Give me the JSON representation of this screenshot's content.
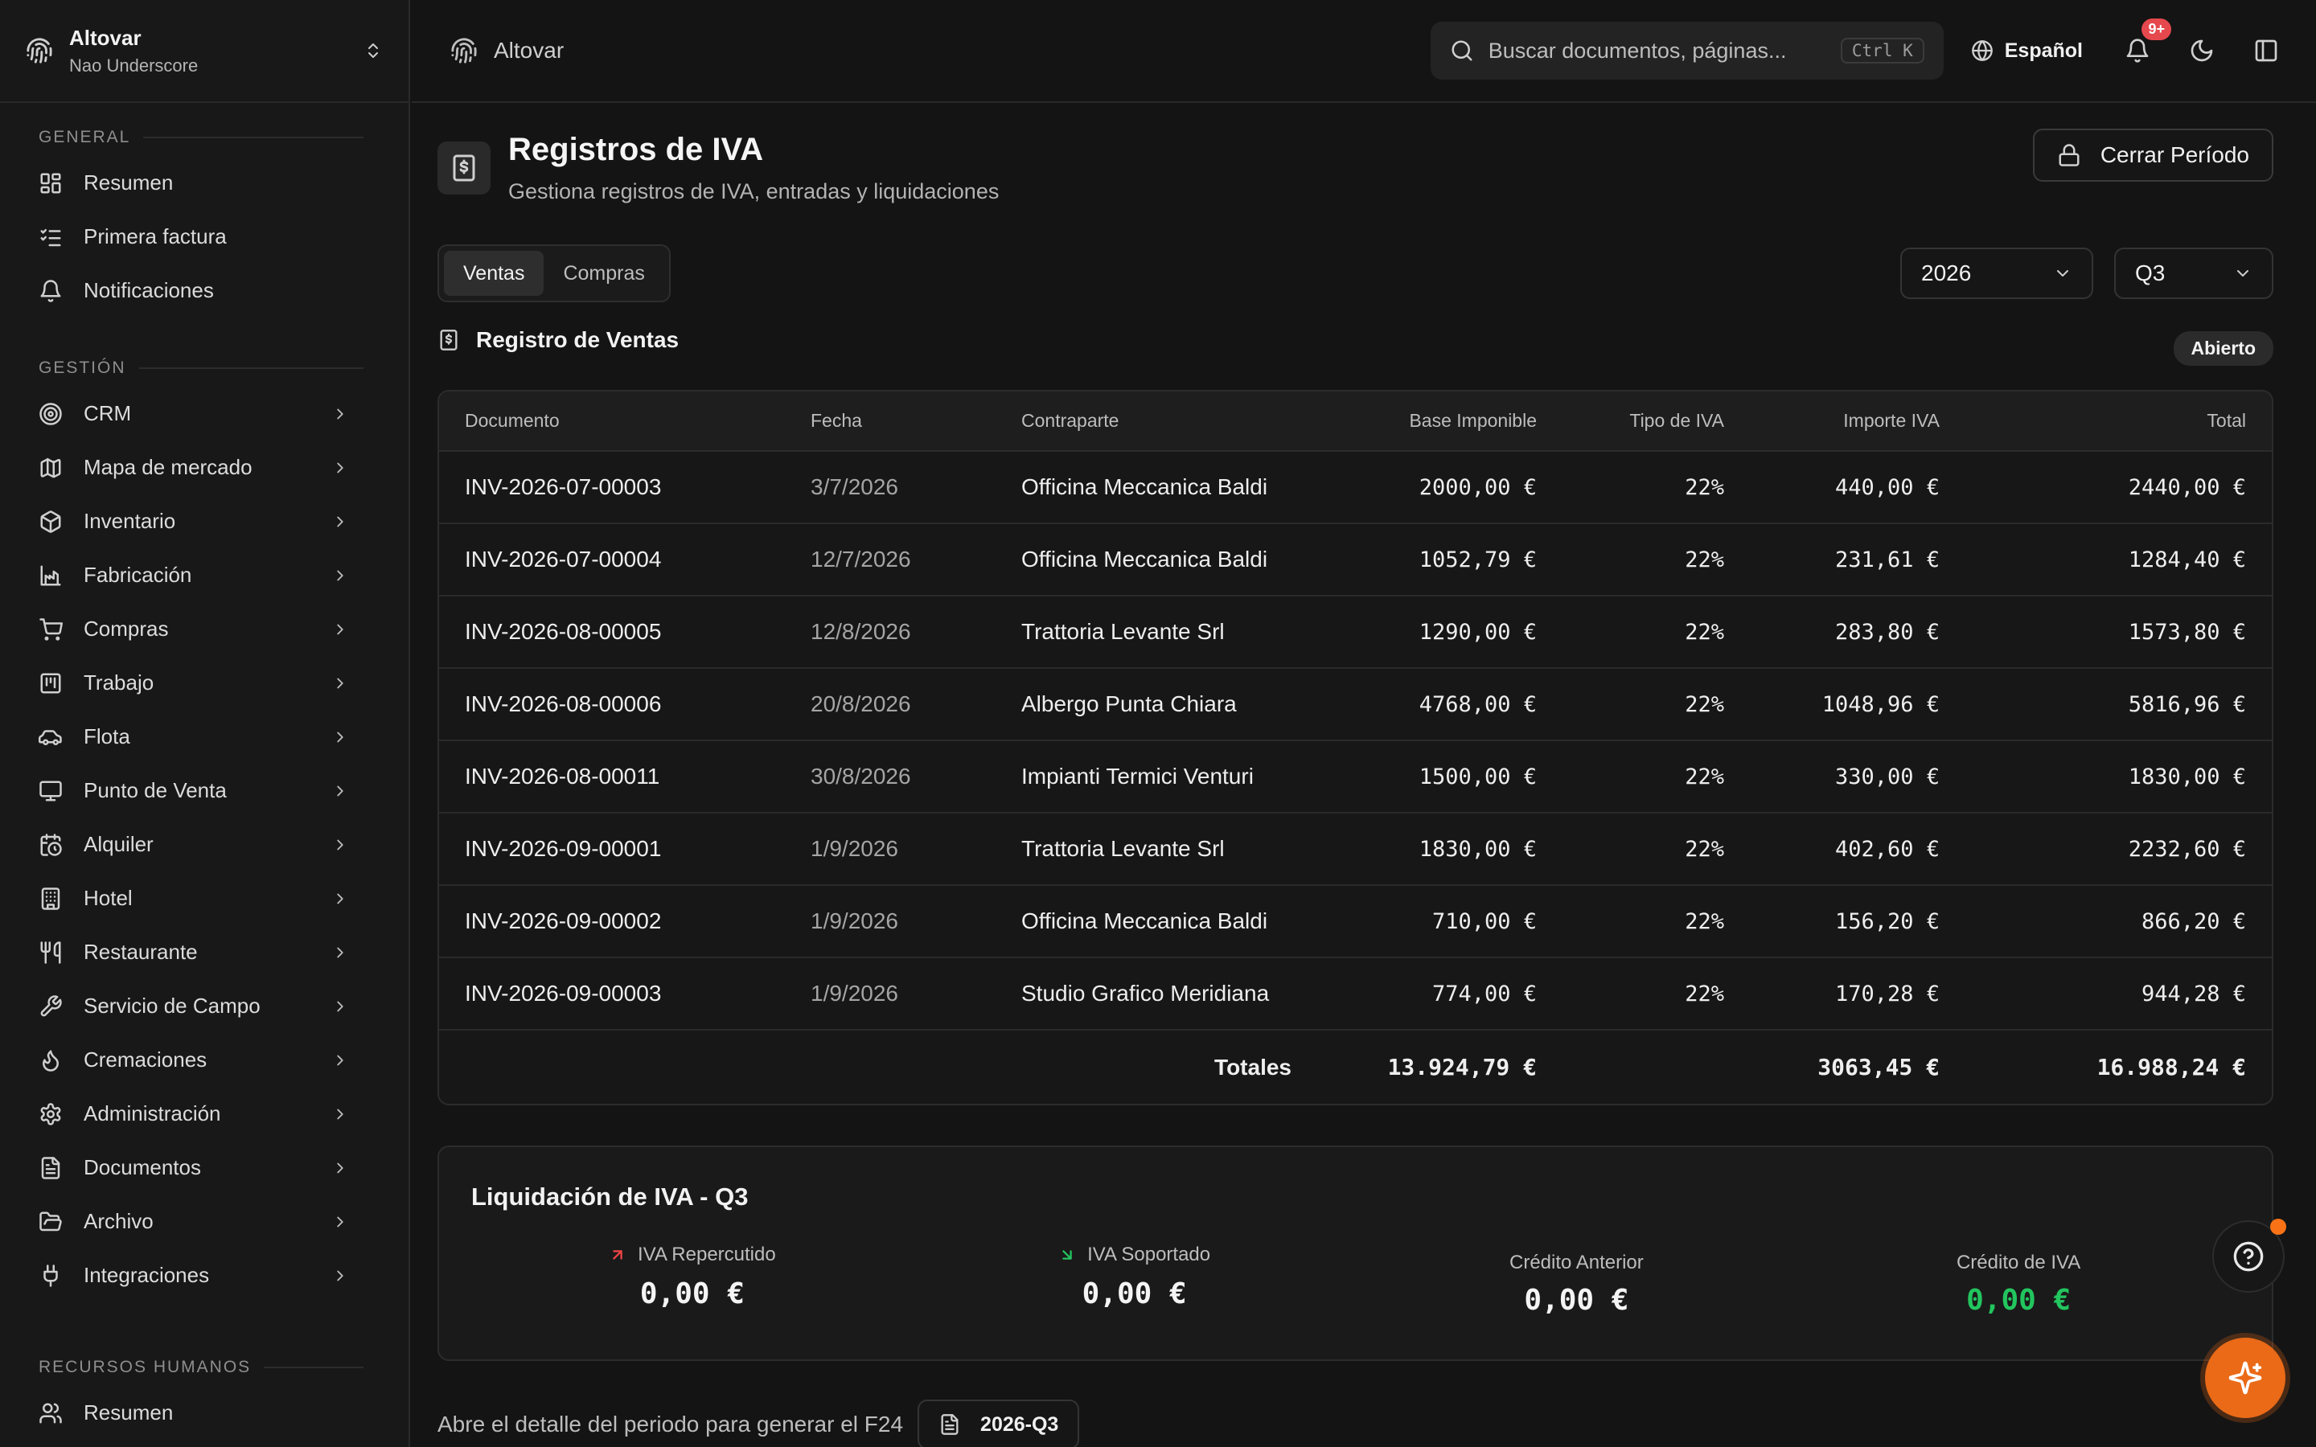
{
  "workspace": {
    "name": "Altovar",
    "user": "Nao Underscore"
  },
  "sidebar": {
    "sections": [
      {
        "title": "GENERAL",
        "items": [
          {
            "label": "Resumen",
            "icon": "dashboard-icon",
            "chevron": false
          },
          {
            "label": "Primera factura",
            "icon": "checklist-icon",
            "chevron": false
          },
          {
            "label": "Notificaciones",
            "icon": "bell-icon",
            "chevron": false
          }
        ]
      },
      {
        "title": "GESTIÓN",
        "items": [
          {
            "label": "CRM",
            "icon": "target-icon",
            "chevron": true
          },
          {
            "label": "Mapa de mercado",
            "icon": "map-icon",
            "chevron": true
          },
          {
            "label": "Inventario",
            "icon": "box-icon",
            "chevron": true
          },
          {
            "label": "Fabricación",
            "icon": "factory-icon",
            "chevron": true
          },
          {
            "label": "Compras",
            "icon": "cart-icon",
            "chevron": true
          },
          {
            "label": "Trabajo",
            "icon": "kanban-icon",
            "chevron": true
          },
          {
            "label": "Flota",
            "icon": "car-icon",
            "chevron": true
          },
          {
            "label": "Punto de Venta",
            "icon": "monitor-icon",
            "chevron": true
          },
          {
            "label": "Alquiler",
            "icon": "calendar-clock-icon",
            "chevron": true
          },
          {
            "label": "Hotel",
            "icon": "building-icon",
            "chevron": true
          },
          {
            "label": "Restaurante",
            "icon": "utensils-icon",
            "chevron": true
          },
          {
            "label": "Servicio de Campo",
            "icon": "wrench-icon",
            "chevron": true
          },
          {
            "label": "Cremaciones",
            "icon": "flame-icon",
            "chevron": true
          },
          {
            "label": "Administración",
            "icon": "gear-icon",
            "chevron": true
          },
          {
            "label": "Documentos",
            "icon": "document-icon",
            "chevron": true
          },
          {
            "label": "Archivo",
            "icon": "folder-open-icon",
            "chevron": true
          },
          {
            "label": "Integraciones",
            "icon": "plug-icon",
            "chevron": true
          }
        ]
      },
      {
        "title": "RECURSOS HUMANOS",
        "items": [
          {
            "label": "Resumen",
            "icon": "users-icon",
            "chevron": false
          }
        ]
      }
    ]
  },
  "topbar": {
    "breadcrumb": "Altovar",
    "search_placeholder": "Buscar documentos, páginas...",
    "search_shortcut": "Ctrl K",
    "language": "Español",
    "notifications_badge": "9+"
  },
  "page": {
    "title": "Registros de IVA",
    "subtitle": "Gestiona registros de IVA, entradas y liquidaciones",
    "close_period_label": "Cerrar Período",
    "tabs": [
      {
        "label": "Ventas",
        "active": true
      },
      {
        "label": "Compras",
        "active": false
      }
    ],
    "year": "2026",
    "quarter": "Q3",
    "register_title": "Registro de Ventas",
    "status": "Abierto"
  },
  "table": {
    "headers": {
      "documento": "Documento",
      "fecha": "Fecha",
      "contraparte": "Contraparte",
      "base": "Base Imponible",
      "tipo": "Tipo de IVA",
      "importe": "Importe IVA",
      "total": "Total"
    },
    "rows": [
      {
        "documento": "INV-2026-07-00003",
        "fecha": "3/7/2026",
        "contraparte": "Officina Meccanica Baldi",
        "base": "2000,00 €",
        "tipo": "22%",
        "importe": "440,00 €",
        "total": "2440,00 €"
      },
      {
        "documento": "INV-2026-07-00004",
        "fecha": "12/7/2026",
        "contraparte": "Officina Meccanica Baldi",
        "base": "1052,79 €",
        "tipo": "22%",
        "importe": "231,61 €",
        "total": "1284,40 €"
      },
      {
        "documento": "INV-2026-08-00005",
        "fecha": "12/8/2026",
        "contraparte": "Trattoria Levante Srl",
        "base": "1290,00 €",
        "tipo": "22%",
        "importe": "283,80 €",
        "total": "1573,80 €"
      },
      {
        "documento": "INV-2026-08-00006",
        "fecha": "20/8/2026",
        "contraparte": "Albergo Punta Chiara",
        "base": "4768,00 €",
        "tipo": "22%",
        "importe": "1048,96 €",
        "total": "5816,96 €"
      },
      {
        "documento": "INV-2026-08-00011",
        "fecha": "30/8/2026",
        "contraparte": "Impianti Termici Venturi",
        "base": "1500,00 €",
        "tipo": "22%",
        "importe": "330,00 €",
        "total": "1830,00 €"
      },
      {
        "documento": "INV-2026-09-00001",
        "fecha": "1/9/2026",
        "contraparte": "Trattoria Levante Srl",
        "base": "1830,00 €",
        "tipo": "22%",
        "importe": "402,60 €",
        "total": "2232,60 €"
      },
      {
        "documento": "INV-2026-09-00002",
        "fecha": "1/9/2026",
        "contraparte": "Officina Meccanica Baldi",
        "base": "710,00 €",
        "tipo": "22%",
        "importe": "156,20 €",
        "total": "866,20 €"
      },
      {
        "documento": "INV-2026-09-00003",
        "fecha": "1/9/2026",
        "contraparte": "Studio Grafico Meridiana",
        "base": "774,00 €",
        "tipo": "22%",
        "importe": "170,28 €",
        "total": "944,28 €"
      }
    ],
    "totals": {
      "label": "Totales",
      "base": "13.924,79 €",
      "importe": "3063,45 €",
      "total": "16.988,24 €"
    }
  },
  "liquidacion": {
    "title": "Liquidación de IVA - Q3",
    "repercutido_label": "IVA Repercutido",
    "repercutido_value": "0,00 €",
    "soportado_label": "IVA Soportado",
    "soportado_value": "0,00 €",
    "credito_anterior_label": "Crédito Anterior",
    "credito_anterior_value": "0,00 €",
    "credito_iva_label": "Crédito de IVA",
    "credito_iva_value": "0,00 €"
  },
  "footer": {
    "text": "Abre el detalle del periodo para generar el F24",
    "period": "2026-Q3"
  },
  "colors": {
    "accent": "#ea6a17",
    "positive": "#22c55e",
    "negative": "#ef4444",
    "badge": "#e5484d"
  }
}
